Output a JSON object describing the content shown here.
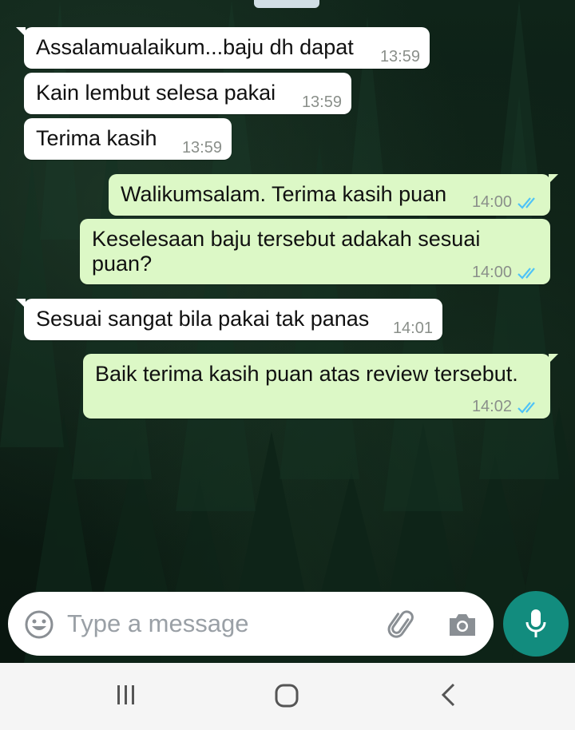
{
  "messages": [
    {
      "direction": "in",
      "text": "Assalamualaikum...baju dh dapat",
      "time": "13:59"
    },
    {
      "direction": "in",
      "text": "Kain lembut selesa pakai",
      "time": "13:59"
    },
    {
      "direction": "in",
      "text": "Terima kasih",
      "time": "13:59"
    },
    {
      "direction": "out",
      "text": "Walikumsalam.  Terima kasih puan",
      "time": "14:00",
      "status": "read"
    },
    {
      "direction": "out",
      "text": "Keselesaan baju tersebut adakah sesuai puan?",
      "time": "14:00",
      "status": "read"
    },
    {
      "direction": "in",
      "text": "Sesuai sangat bila pakai tak panas",
      "time": "14:01"
    },
    {
      "direction": "out",
      "text": "Baik terima kasih puan atas review tersebut.",
      "time": "14:02",
      "status": "read"
    }
  ],
  "composer": {
    "placeholder": "Type a message"
  },
  "icons": {
    "emoji": "emoji-icon",
    "attach": "paperclip-icon",
    "camera": "camera-icon",
    "mic": "microphone-icon",
    "read_tick": "double-check-icon",
    "nav_recents": "recents-icon",
    "nav_home": "home-icon",
    "nav_back": "back-icon"
  },
  "colors": {
    "incoming_bubble": "#ffffff",
    "outgoing_bubble": "#dcf8c6",
    "read_tick": "#4fc3f7",
    "mic_button": "#128c7e"
  }
}
